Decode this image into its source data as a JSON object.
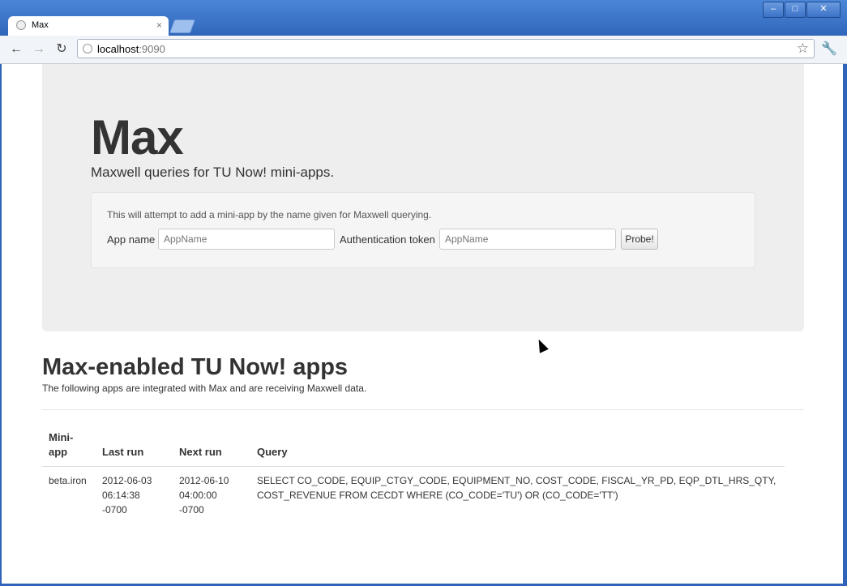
{
  "browser": {
    "tab_title": "Max",
    "tab_close": "×",
    "url_host": "localhost",
    "url_port": ":9090",
    "window_controls": {
      "minimize": "–",
      "maximize": "□",
      "close": "✕"
    }
  },
  "hero": {
    "title": "Max",
    "tagline": "Maxwell queries for TU Now! mini-apps.",
    "help_text": "This will attempt to add a mini-app by the name given for Maxwell querying.",
    "app_name_label": "App name",
    "app_name_placeholder": "AppName",
    "auth_label": "Authentication token",
    "auth_placeholder": "AppName",
    "probe_button": "Probe!"
  },
  "apps_section": {
    "title": "Max-enabled TU Now! apps",
    "subtitle": "The following apps are integrated with Max and are receiving Maxwell data.",
    "columns": [
      "Mini-app",
      "Last run",
      "Next run",
      "Query"
    ],
    "rows": [
      {
        "mini_app": "beta.iron",
        "last_run": "2012-06-03 06:14:38 -0700",
        "next_run": "2012-06-10 04:00:00 -0700",
        "query": "SELECT CO_CODE, EQUIP_CTGY_CODE, EQUIPMENT_NO, COST_CODE, FISCAL_YR_PD, EQP_DTL_HRS_QTY, COST_REVENUE FROM CECDT WHERE (CO_CODE='TU') OR (CO_CODE='TT')"
      }
    ]
  }
}
